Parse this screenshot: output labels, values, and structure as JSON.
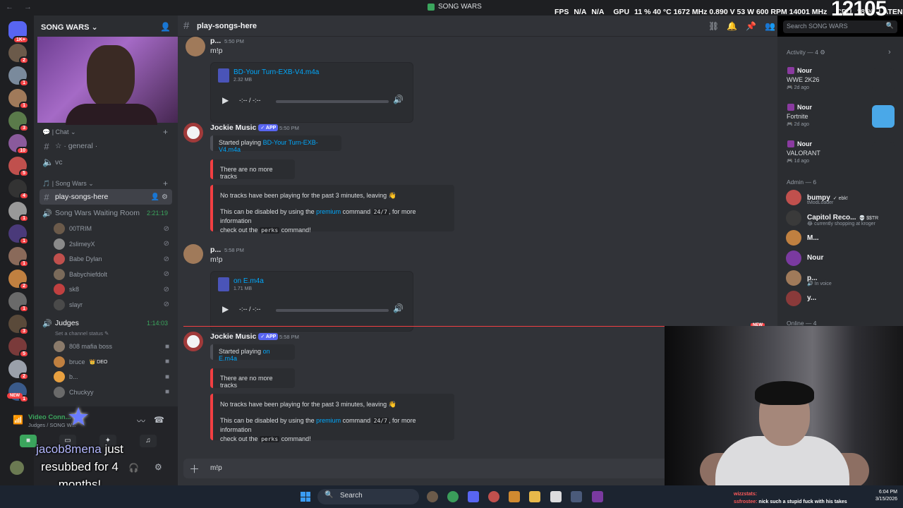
{
  "window": {
    "title": "SONG WARS",
    "nav_arrows": "← →"
  },
  "overlay": {
    "fps_label": "FPS",
    "fps_value": "N/A",
    "fps_value2": "N/A",
    "gpu_label": "GPU",
    "gpu_stats": "11 % 40 °C 1672 MHz 0.890 V 53 W 600 RPM 14001 MHz",
    "cpu_label": "CPU",
    "cpu_value": "18 %",
    "cpu_extra": "LATEN",
    "big_number": "12105"
  },
  "rail": {
    "top_badge": "1K+",
    "new_label": "NEW",
    "servers": [
      {
        "color": "#6b5a4a",
        "badge": "2"
      },
      {
        "color": "#7a8a9c",
        "badge": "1"
      },
      {
        "color": "#a07a5a",
        "badge": "1"
      },
      {
        "color": "#5a7a4a",
        "badge": "3"
      },
      {
        "color": "#8a5a9c",
        "badge": "10"
      },
      {
        "color": "#c0504d",
        "badge": "5"
      },
      {
        "color": "#333333",
        "badge": "4"
      },
      {
        "color": "#999999",
        "badge": "1"
      },
      {
        "color": "#4a3a7a",
        "badge": "1"
      },
      {
        "color": "#8a6a5a",
        "badge": "1"
      },
      {
        "color": "#c08040",
        "badge": "2"
      },
      {
        "color": "#6a6a6a",
        "badge": "1"
      },
      {
        "color": "#5a4a3a",
        "badge": "3"
      },
      {
        "color": "#7a3a3a",
        "badge": "5"
      },
      {
        "color": "#9aa0aa",
        "badge": "2"
      },
      {
        "color": "#3a5a8a",
        "badge": "1"
      }
    ]
  },
  "sidebar": {
    "server_name": "SONG WARS ⌄",
    "cat_chat": "💬 | Chat ⌄",
    "ch_general": "☆ · general ·",
    "ch_vc": "vc",
    "cat_songwars": "🎵 | Song Wars ⌄",
    "ch_play": "play-songs-here",
    "vc_waiting": "Song Wars Waiting Room",
    "vc_waiting_time": "2:21:19",
    "waiting_users": [
      "00TRIM",
      "2slimeyX",
      "Babe Dylan",
      "Babychiefdolt",
      "sk8",
      "slayr"
    ],
    "vc_judges": "Judges",
    "vc_judges_time": "1:14:03",
    "judges_status": "Set a channel status ✎",
    "judge_users": [
      "808 mafia boss",
      "bruce",
      "b...",
      "Chuckyy"
    ],
    "bruce_tag": "👑 DEO",
    "voice_title": "Video Conn...",
    "voice_sub": "Judges / SONG W...",
    "sub_alert_name": "jacob8mena",
    "sub_alert_text": "just resubbed for 4 months!"
  },
  "channel": {
    "name": "play-songs-here",
    "search_placeholder": "Search SONG WARS"
  },
  "messages": {
    "m1_author": "p...",
    "m1_time": "5:50 PM",
    "m1_text": "m!p",
    "m1_file": "BD-Your Turn-EXB-V4.m4a",
    "m1_size": "2.32 MB",
    "player_time": "-:-- / -:--",
    "bot_name": "Jockie Music",
    "app_tag": "✓ APP",
    "m2_time": "5:50 PM",
    "started_playing": "Started playing",
    "m2_track": "BD-Your Turn-EXB-V4.m4a",
    "no_more": "There are no more tracks",
    "no_tracks": "No tracks have been playing for the past 3 minutes, leaving 👋",
    "disable_pre": "This can be disabled by using the",
    "disable_link": "premium",
    "disable_mid": "command",
    "disable_code1": "24/7",
    "disable_post": ", for more information",
    "checkout_pre": "check out the",
    "checkout_code": "perks",
    "checkout_post": "command!",
    "m3_author": "p...",
    "m3_time": "5:58 PM",
    "m3_text": "m!p",
    "m3_file": "on E.m4a",
    "m3_size": "1.71 MB",
    "m4_time": "5:58 PM",
    "m4_track": "on E.m4a",
    "new_tag": "NEW",
    "composer_value": "m!p"
  },
  "right": {
    "activity_head": "Activity — 4 ⚙",
    "activities": [
      {
        "name": "Nour",
        "game": "WWE 2K26",
        "ago": "🎮 2d ago"
      },
      {
        "name": "Nour",
        "game": "Fortnite",
        "ago": "🎮 2d ago"
      },
      {
        "name": "Nour",
        "game": "VALORANT",
        "ago": "🎮 1d ago"
      }
    ],
    "admin_head": "Admin — 6",
    "admins": [
      {
        "name": "bumpy",
        "tag": "✓ ebk!",
        "status": "tModLoader",
        "color": "#c0504d"
      },
      {
        "name": "Capitol Reco...",
        "tag": "💀 $$TR",
        "status": "😂 currently shopping at kroger",
        "color": "#3a3a3a"
      },
      {
        "name": "M...",
        "tag": "",
        "status": "",
        "color": "#c08040"
      },
      {
        "name": "Nour",
        "tag": "",
        "status": "",
        "color": "#7a3aa0"
      },
      {
        "name": "p...",
        "tag": "",
        "status": "🔊 In voice",
        "color": "#a07a5a"
      },
      {
        "name": "y...",
        "tag": "",
        "status": "",
        "color": "#8a3a3a"
      }
    ],
    "online_head": "Online — 4"
  },
  "taskbar": {
    "search_label": "Search",
    "clock": "6:04 PM",
    "date": "3/15/2026",
    "chat_user1": "wizzstats:",
    "chat_user2": "ssfrostee:",
    "chat_msg": "nick such a stupid fuck with his takes"
  }
}
